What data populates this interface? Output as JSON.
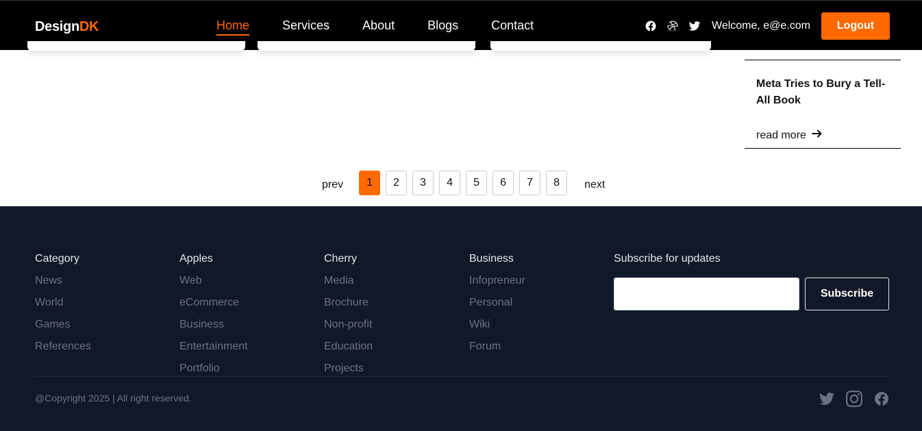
{
  "brand": {
    "name_part1": "Design",
    "name_part2": "DK",
    "accent_color": "#ff6a00"
  },
  "nav": {
    "links": [
      "Home",
      "Services",
      "About",
      "Blogs",
      "Contact"
    ],
    "active": "Home",
    "welcome": "Welcome, e@e.com",
    "logout_label": "Logout",
    "social_icons": [
      "facebook-icon",
      "dribbble-icon",
      "twitter-icon"
    ]
  },
  "sidebar_article": {
    "title": "Meta Tries to Bury a Tell-All Book",
    "read_more": "read more"
  },
  "pagination": {
    "prev": "prev",
    "next": "next",
    "pages": [
      "1",
      "2",
      "3",
      "4",
      "5",
      "6",
      "7",
      "8"
    ],
    "current": "1"
  },
  "footer": {
    "columns": [
      {
        "heading": "Category",
        "links": [
          "News",
          "World",
          "Games",
          "References"
        ]
      },
      {
        "heading": "Apples",
        "links": [
          "Web",
          "eCommerce",
          "Business",
          "Entertainment",
          "Portfolio"
        ]
      },
      {
        "heading": "Cherry",
        "links": [
          "Media",
          "Brochure",
          "Non-profit",
          "Education",
          "Projects"
        ]
      },
      {
        "heading": "Business",
        "links": [
          "Infopreneur",
          "Personal",
          "Wiki",
          "Forum"
        ]
      }
    ],
    "subscribe": {
      "heading": "Subscribe for updates",
      "placeholder": "",
      "button": "Subscribe"
    },
    "copyright": "@Copyright 2025 | All right reserved.",
    "social_icons": [
      "twitter-icon",
      "instagram-icon",
      "facebook-icon"
    ],
    "background": "#111827"
  }
}
